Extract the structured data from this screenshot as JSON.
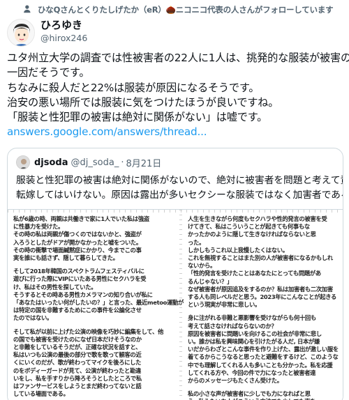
{
  "social_context": {
    "text": "ひなQさんとくりたしげたか（eR）🌰ニコニコ代表の人さんがフォローしています",
    "icon": "user-follow-icon"
  },
  "author": {
    "name": "ひろゆき",
    "handle": "@hirox246",
    "avatar": "avatar-face"
  },
  "tweet": {
    "lines": [
      "ユタ州立大学の調査では性被害者の22人に1人は、挑発的な服装が被害の",
      "一因だそうです。",
      "ちなみに殺人だと22%は服装が原因になるそうです。",
      "治安の悪い場所では服装に気をつけたほうが良いですね。",
      "「服装と性犯罪の被害は絶対に関係がない」は嘘です。"
    ],
    "link": "answers.google.com/answers/thread..."
  },
  "quote": {
    "name": "djsoda",
    "handle": "@dj_soda_",
    "separator": "·",
    "date": "8月21日",
    "lines": [
      "服装と性犯罪の被害は絶対に関係がないので、絶対に被害者を問題と考えて責任",
      "転嫁してはいけない。原因は露出が多いセクシーな服装ではなく加害者である。"
    ],
    "image": {
      "left_column": [
        [
          "私が6歳の時、両親は共働きで家に1人でいた私は強盗",
          "に性暴力を受けた。",
          "その時の私は両親が傷つくのではないかと、強盗が",
          "入ろうとしたがドアが開かなかったと嘘をついた。",
          "その時の衝撃で場面緘黙症にかかり、今までこの事",
          "実を誰にも話さず、隠して暮らしてきた。"
        ],
        [
          "そして2018年韓国のスペクトラムフェスティバルに",
          "遊びに行った際にVIPにいたある男性にセクハラを受",
          "け、私はその男性を探していた。",
          "そうするとその時ある男性カメラマンの知り合いが私に",
          "「あなたはいったい何がしたいの？」と言った、最近metoo運動が",
          "は特定の国を非難するためにこの事件を公論化させ",
          "たのではない。"
        ],
        [
          "そして私が以前に上げた公演の映像を巧妙に編集をして、他",
          "の国でも被害を受けたのになぜ日本だけそうなのか",
          "と非難をしているそうだが、正確な状況を話すと、",
          "私はいつも公演の最後の部分で歌を歌って観客の近",
          "くにいくのだが、歌が終わってマイクを後ろにした",
          "のをボディーガードが見て、公演が終わったと勘違",
          "いをし、私を手すりから降ろそうとしたところで私",
          "はファンサービスをしようとまだ終わってないと話",
          "している場面である。"
        ]
      ],
      "right_column": [
        [
          "人生を生きながら何度もセクハラや性的発言の被害を受",
          "けてきて、私はこういうことが起きても何事もな",
          "かったかのように隠して生きなければならないと思",
          "った。",
          "しかしもうこれ以上我慢したくはない。",
          "これを無視することはまた別の人が被害者になるかもしれ",
          "ないから。",
          "「性的発言を受けたことはあなたにとっても問題があ",
          "るんじゃない？」",
          "なぜ被害者が原因追及をするのか？私は加害者も二次加害",
          "する人も同レベルだと思う。2023年にこんなことが起きる",
          "という現実が非常に悲しい。"
        ],
        [
          "身に注がれる非難と悪影響を受けながらも何十回も",
          "考えて話さなければならないのか？",
          "原因を被害者に問題いを向けるこの社会が非常に悲し",
          "い。誰かは私を興味関心を引けたがる人だ, 日本が嫌",
          "いだからわざとこんな事件を作り上げた、露出が激しい服を",
          "着てるからこうなると思ったと避難をするけど、このような",
          "中でも理解してくれる人も多いことも分かった。私を応援",
          "してくれる方や、今回の件で力になったと被害者達",
          "からのメッセージもたくさん受けた。"
        ],
        [
          "私の小さな声が被害者に少しでも力になればと思",
          "う。私みたいな人がこういう方法でも少しでも声を"
        ]
      ]
    }
  }
}
